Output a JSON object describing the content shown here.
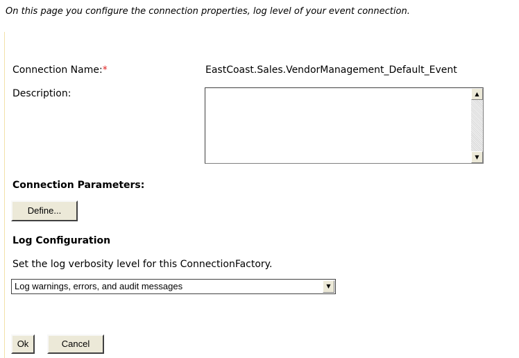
{
  "intro_text": "On this page you configure the connection properties, log level of your event connection.",
  "form": {
    "connection_name_label": "Connection Name:",
    "required_marker": "*",
    "connection_name_value": "EastCoast.Sales.VendorManagement_Default_Event",
    "description_label": "Description:",
    "description_value": ""
  },
  "connection_parameters": {
    "heading": "Connection Parameters:",
    "define_button": "Define..."
  },
  "log_configuration": {
    "heading": "Log Configuration",
    "help_text": "Set the log verbosity level for this ConnectionFactory.",
    "selected_option": "Log warnings, errors, and audit messages"
  },
  "actions": {
    "ok_button": "Ok",
    "cancel_button": "Cancel"
  },
  "icons": {
    "scroll_up": "scroll-up-arrow-icon",
    "scroll_down": "scroll-down-arrow-icon",
    "dropdown": "dropdown-arrow-icon"
  },
  "colors": {
    "required_marker": "#e02020",
    "button_face": "#ece9d8"
  }
}
